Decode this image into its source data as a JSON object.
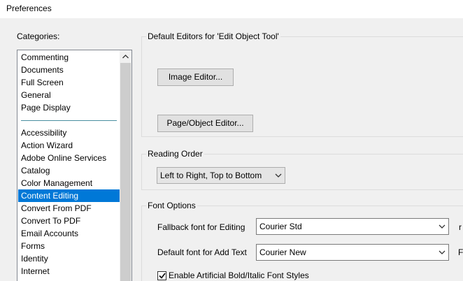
{
  "window": {
    "title": "Preferences"
  },
  "categories": {
    "label": "Categories:",
    "group1": [
      "Commenting",
      "Documents",
      "Full Screen",
      "General",
      "Page Display"
    ],
    "group2": [
      "Accessibility",
      "Action Wizard",
      "Adobe Online Services",
      "Catalog",
      "Color Management",
      "Content Editing",
      "Convert From PDF",
      "Convert To PDF",
      "Email Accounts",
      "Forms",
      "Identity",
      "Internet"
    ],
    "selected": "Content Editing"
  },
  "default_editors": {
    "label": "Default Editors for 'Edit Object Tool'",
    "image_editor_button": "Image Editor...",
    "page_object_editor_button": "Page/Object Editor..."
  },
  "reading_order": {
    "label": "Reading Order",
    "value": "Left to Right, Top to Bottom"
  },
  "font_options": {
    "label": "Font Options",
    "fallback_label": "Fallback font for Editing",
    "fallback_value": "Courier Std",
    "default_label": "Default font for Add Text",
    "default_value": "Courier New",
    "artificial_label": "Enable Artificial Bold/Italic Font Styles",
    "artificial_checked": true,
    "cut_fallback_right": "r",
    "cut_default_right": "F"
  }
}
